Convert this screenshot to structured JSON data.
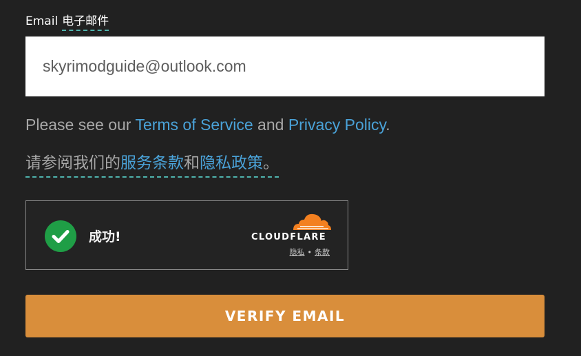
{
  "email_field": {
    "label": "Email",
    "label_translation": "电子邮件",
    "value": "skyrimodguide@outlook.com"
  },
  "terms_english": {
    "prefix": "Please see our ",
    "terms_link": "Terms of Service",
    "conjunction": " and ",
    "privacy_link": "Privacy Policy",
    "suffix": "."
  },
  "terms_chinese": {
    "prefix": "请参阅我们的",
    "terms_link": "服务条款",
    "conjunction": "和",
    "privacy_link": "隐私政策",
    "suffix": "。"
  },
  "captcha": {
    "status_text": "成功!",
    "status_icon": "check-circle-icon",
    "brand": "CLOUDFLARE",
    "privacy_link": "隐私",
    "separator": "•",
    "terms_link": "条款"
  },
  "verify_button": {
    "label": "VERIFY EMAIL"
  },
  "colors": {
    "background": "#212121",
    "link": "#4aa2d8",
    "button": "#d98e3b",
    "success": "#1f9e46",
    "cloudflare_orange": "#f38020"
  }
}
